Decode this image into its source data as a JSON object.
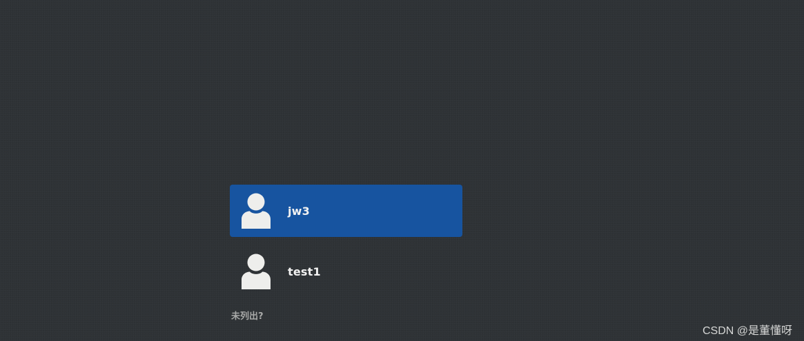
{
  "users": [
    {
      "name": "jw3",
      "selected": true,
      "icon": "user-avatar-icon"
    },
    {
      "name": "test1",
      "selected": false,
      "icon": "user-avatar-icon"
    }
  ],
  "not_listed_label": "未列出?",
  "watermark": "CSDN @是董懂呀",
  "colors": {
    "background": "#2e3235",
    "selected": "#1754a0",
    "text": "#f2f2f2",
    "muted_text": "#a9aaa9",
    "avatar": "#eeeeec"
  }
}
